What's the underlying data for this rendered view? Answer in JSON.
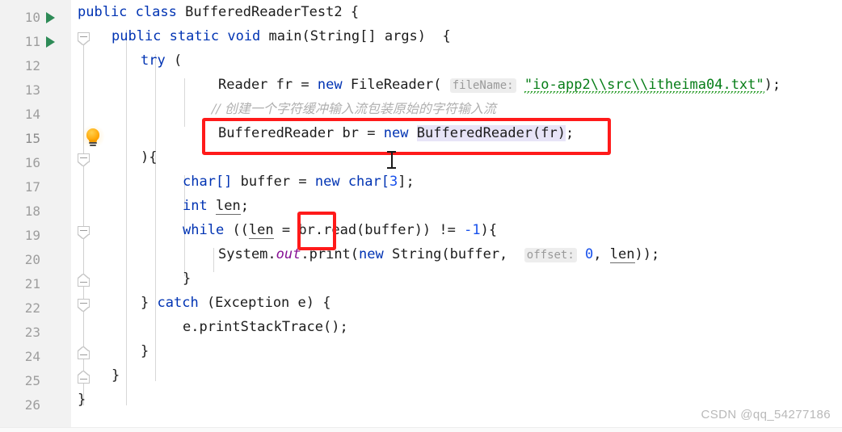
{
  "editor": {
    "app": "java-code-editor",
    "first_line": 10,
    "line_height": 30,
    "watermark": "CSDN @qq_54277186",
    "colors": {
      "gutter_bg": "#f2f2f2",
      "editor_bg": "#ffffff",
      "caret_row": "#fdf8ee",
      "keyword": "#0033b3",
      "string": "#067d17",
      "number": "#1750eb",
      "comment": "#b0b0b0",
      "field": "#871094",
      "hint_bg": "#ededed",
      "usage_highlight": "#e7e4f7",
      "annotation_red": "#ff1a1a",
      "run_arrow_green": "#2e8b57",
      "bulb_orange": "#ffa300"
    },
    "lines": [
      {
        "n": "10",
        "run": true,
        "fold": "start",
        "text": "public class BufferedReaderTest2 {"
      },
      {
        "n": "11",
        "run": true,
        "fold": "start",
        "text": "    public static void main(String[] args)  {"
      },
      {
        "n": "12",
        "run": false,
        "fold": "none",
        "text": "        try ("
      },
      {
        "n": "13",
        "run": false,
        "fold": "none",
        "text": "            Reader fr = new FileReader( fileName: \"io-app2\\\\src\\\\itheima04.txt\");"
      },
      {
        "n": "14",
        "run": false,
        "fold": "none",
        "text": "            // 创建一个字符缓冲输入流包装原始的字符输入流"
      },
      {
        "n": "15",
        "run": false,
        "fold": "none",
        "text": "            BufferedReader br = new BufferedReader(fr);",
        "caret": true,
        "bulb": true
      },
      {
        "n": "16",
        "run": false,
        "fold": "start",
        "text": "        ){"
      },
      {
        "n": "17",
        "run": false,
        "fold": "none",
        "text": "            char[] buffer = new char[3];"
      },
      {
        "n": "18",
        "run": false,
        "fold": "none",
        "text": "            int len;"
      },
      {
        "n": "19",
        "run": false,
        "fold": "start",
        "text": "            while ((len = br.read(buffer)) != -1){"
      },
      {
        "n": "20",
        "run": false,
        "fold": "none",
        "text": "                System.out.print(new String(buffer,  offset: 0, len));"
      },
      {
        "n": "21",
        "run": false,
        "fold": "end",
        "text": "            }"
      },
      {
        "n": "22",
        "run": false,
        "fold": "start",
        "text": "        } catch (Exception e) {"
      },
      {
        "n": "23",
        "run": false,
        "fold": "none",
        "text": "            e.printStackTrace();"
      },
      {
        "n": "24",
        "run": false,
        "fold": "end",
        "text": "        }"
      },
      {
        "n": "25",
        "run": false,
        "fold": "end",
        "text": "    }"
      },
      {
        "n": "26",
        "run": false,
        "fold": "end",
        "text": "}"
      }
    ],
    "tokens": {
      "l10": {
        "kw1": "public",
        "kw2": "class",
        "name": "BufferedReaderTest2",
        "brace": "{"
      },
      "l11": {
        "kw1": "public",
        "kw2": "static",
        "kw3": "void",
        "name": "main",
        "params": "(String[] args)",
        "brace": "{"
      },
      "l12": {
        "kw": "try",
        "paren": "("
      },
      "l13": {
        "type": "Reader",
        "var": "fr",
        "eq": "=",
        "kw": "new",
        "ctor": "FileReader(",
        "hint": "fileName:",
        "str": "\"io-app2\\\\src\\\\itheima04.txt\"",
        "tail": ");"
      },
      "l14": {
        "comment": "// 创建一个字符缓冲输入流包装原始的字符输入流"
      },
      "l15": {
        "type": "BufferedReader",
        "var": "br",
        "eq": "=",
        "kw": "new",
        "ctor": "BufferedReader(fr)",
        "semi": ";"
      },
      "l16": {
        "text": "){"
      },
      "l17": {
        "type": "char[]",
        "var": "buffer",
        "eq": "=",
        "kw": "new",
        "alloc": "char[",
        "num": "3",
        "tail": "];"
      },
      "l18": {
        "kw": "int",
        "var": "len",
        "semi": ";"
      },
      "l19": {
        "kw": "while",
        "open": "((",
        "var": "len",
        "eq": "=",
        "recv": "br.",
        "call": "read(buffer))",
        "op": "!=",
        "neg": "-1",
        "tail": "){"
      },
      "l20": {
        "obj": "System.",
        "field": "out",
        "call": ".print(",
        "kw": "new",
        "type": "String(buffer, ",
        "hint": "offset:",
        "num": "0",
        "sep": ", ",
        "var": "len",
        "tail": "));"
      },
      "l21": {
        "text": "}"
      },
      "l22": {
        "close": "}",
        "kw": "catch",
        "params": "(Exception e)",
        "brace": "{"
      },
      "l23": {
        "text": "e.printStackTrace();"
      },
      "l24": {
        "text": "}"
      },
      "l25": {
        "text": "}"
      },
      "l26": {
        "text": "}"
      }
    }
  },
  "annotations": {
    "box_main": {
      "label": "red-rectangle-around-buffered-reader-line"
    },
    "box_br": {
      "label": "red-rectangle-around-br-variable"
    },
    "cursor": {
      "label": "text-ibeam-cursor"
    }
  }
}
